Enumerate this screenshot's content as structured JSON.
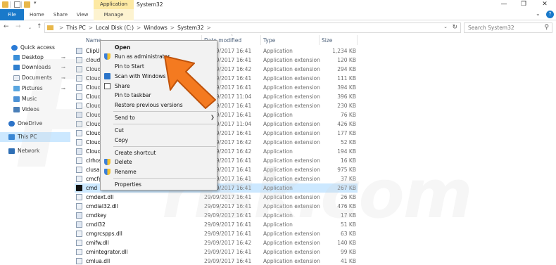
{
  "window": {
    "title": "System32",
    "context_tab_title": "Application Tools",
    "controls": {
      "minimize": "—",
      "maximize": "❐",
      "close": "✕"
    }
  },
  "ribbon": {
    "tabs": [
      "File",
      "Home",
      "Share",
      "View",
      "Manage"
    ],
    "help": "?",
    "expand": "⌄"
  },
  "address": {
    "crumbs": [
      "This PC",
      "Local Disk (C:)",
      "Windows",
      "System32"
    ],
    "separator": ">",
    "search_placeholder": "Search System32"
  },
  "icons": {
    "back": "←",
    "forward": "→",
    "history": "⌄",
    "up": "↑",
    "dropdown": "⌄",
    "refresh": "↻",
    "search": "⚲",
    "submenu": "❯",
    "pin": "⊸"
  },
  "navpane": {
    "items": [
      {
        "label": "Quick access",
        "icon": "star-icon",
        "pinned": false
      },
      {
        "label": "Desktop",
        "icon": "desktop-icon",
        "pinned": true
      },
      {
        "label": "Downloads",
        "icon": "downloads-icon",
        "pinned": true
      },
      {
        "label": "Documents",
        "icon": "documents-icon",
        "pinned": true
      },
      {
        "label": "Pictures",
        "icon": "pictures-icon",
        "pinned": true
      },
      {
        "label": "Music",
        "icon": "music-icon",
        "pinned": false
      },
      {
        "label": "Videos",
        "icon": "videos-icon",
        "pinned": false
      },
      {
        "label": "OneDrive",
        "icon": "onedrive-icon",
        "pinned": false
      },
      {
        "label": "This PC",
        "icon": "pc-icon",
        "pinned": false,
        "selected": true
      },
      {
        "label": "Network",
        "icon": "network-icon",
        "pinned": false
      }
    ]
  },
  "columns": {
    "name": "Name",
    "date": "Date modified",
    "type": "Type",
    "size": "Size"
  },
  "files": [
    {
      "name": "ClipUp",
      "date": "29/09/2017 16:41",
      "type": "Application",
      "size": "1,234 KB",
      "icon": "app"
    },
    {
      "name": "cloudA",
      "date": "29/09/2017 16:41",
      "type": "Application extension",
      "size": "120 KB",
      "icon": "dll"
    },
    {
      "name": "CloudI",
      "date": "29/09/2017 16:42",
      "type": "Application extension",
      "size": "294 KB",
      "icon": "dll"
    },
    {
      "name": "CloudI",
      "date": "29/09/2017 16:41",
      "type": "Application extension",
      "size": "111 KB",
      "icon": "dll"
    },
    {
      "name": "CloudI",
      "date": "29/09/2017 16:41",
      "type": "Application extension",
      "size": "394 KB",
      "icon": "dll"
    },
    {
      "name": "CloudI",
      "date": "29/09/2017 11:04",
      "type": "Application extension",
      "size": "396 KB",
      "icon": "dll"
    },
    {
      "name": "CloudI",
      "date": "29/09/2017 16:41",
      "type": "Application extension",
      "size": "230 KB",
      "icon": "dll"
    },
    {
      "name": "CloudI",
      "date": "29/09/2017 16:41",
      "type": "Application",
      "size": "76 KB",
      "icon": "app"
    },
    {
      "name": "CloudI",
      "date": "29/09/2017 11:04",
      "type": "Application extension",
      "size": "426 KB",
      "icon": "dll"
    },
    {
      "name": "CloudI",
      "date": "29/09/2017 16:41",
      "type": "Application extension",
      "size": "177 KB",
      "icon": "dll"
    },
    {
      "name": "CloudI",
      "date": "29/09/2017 16:42",
      "type": "Application extension",
      "size": "52 KB",
      "icon": "dll"
    },
    {
      "name": "CloudS",
      "date": "29/09/2017 16:42",
      "type": "Application",
      "size": "194 KB",
      "icon": "app"
    },
    {
      "name": "clrhost",
      "date": "29/09/2017 16:41",
      "type": "Application extension",
      "size": "16 KB",
      "icon": "dll"
    },
    {
      "name": "clusap",
      "date": "29/09/2017 16:41",
      "type": "Application extension",
      "size": "975 KB",
      "icon": "dll"
    },
    {
      "name": "cmcfg",
      "date": "29/09/2017 16:41",
      "type": "Application extension",
      "size": "37 KB",
      "icon": "dll"
    },
    {
      "name": "cmd",
      "date": "29/09/2017 16:41",
      "type": "Application",
      "size": "267 KB",
      "icon": "cmd",
      "selected": true
    },
    {
      "name": "cmdext.dll",
      "date": "29/09/2017 16:41",
      "type": "Application extension",
      "size": "26 KB",
      "icon": "dll"
    },
    {
      "name": "cmdial32.dll",
      "date": "29/09/2017 16:41",
      "type": "Application extension",
      "size": "476 KB",
      "icon": "dll"
    },
    {
      "name": "cmdkey",
      "date": "29/09/2017 16:41",
      "type": "Application",
      "size": "17 KB",
      "icon": "app"
    },
    {
      "name": "cmdl32",
      "date": "29/09/2017 16:41",
      "type": "Application",
      "size": "51 KB",
      "icon": "app"
    },
    {
      "name": "cmgrcspps.dll",
      "date": "29/09/2017 16:41",
      "type": "Application extension",
      "size": "63 KB",
      "icon": "dll"
    },
    {
      "name": "cmifw.dll",
      "date": "29/09/2017 16:42",
      "type": "Application extension",
      "size": "140 KB",
      "icon": "dll"
    },
    {
      "name": "cmintegrator.dll",
      "date": "29/09/2017 16:41",
      "type": "Application extension",
      "size": "99 KB",
      "icon": "dll"
    },
    {
      "name": "cmlua.dll",
      "date": "29/09/2017 16:41",
      "type": "Application extension",
      "size": "41 KB",
      "icon": "dll"
    }
  ],
  "context_menu": {
    "items": [
      {
        "label": "Open",
        "bold": true,
        "icon": ""
      },
      {
        "label": "Run as administrator",
        "icon": "shield-icon"
      },
      {
        "label": "Pin to Start",
        "icon": ""
      },
      {
        "label": "Scan with Windows Def",
        "icon": "defender-icon"
      },
      {
        "label": "Share",
        "icon": "share-icon"
      },
      {
        "label": "Pin to taskbar",
        "icon": ""
      },
      {
        "label": "Restore previous versions",
        "icon": ""
      },
      {
        "label": "Send to",
        "icon": "",
        "submenu": true
      },
      {
        "label": "Cut",
        "icon": ""
      },
      {
        "label": "Copy",
        "icon": ""
      },
      {
        "label": "Create shortcut",
        "icon": ""
      },
      {
        "label": "Delete",
        "icon": "shield-icon"
      },
      {
        "label": "Rename",
        "icon": "shield-icon"
      },
      {
        "label": "Properties",
        "icon": ""
      }
    ]
  },
  "watermark": {
    "big": "PC",
    "small": "risk.com"
  },
  "colors": {
    "accent": "#1979ca",
    "selection": "#cce8ff",
    "arrow": "#f47a20"
  }
}
